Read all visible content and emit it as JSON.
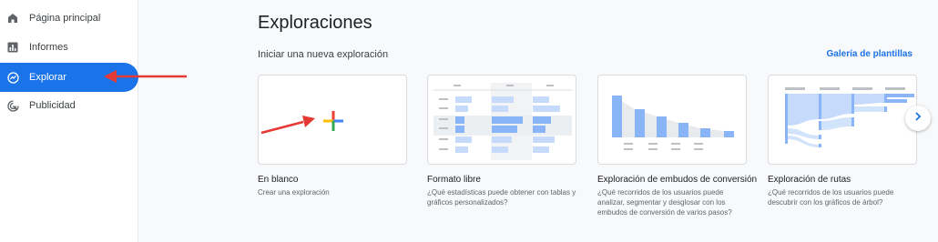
{
  "sidebar": {
    "items": [
      {
        "label": "Página principal",
        "icon": "home-icon"
      },
      {
        "label": "Informes",
        "icon": "bar-chart-icon"
      },
      {
        "label": "Explorar",
        "icon": "explore-icon",
        "active": true
      },
      {
        "label": "Publicidad",
        "icon": "advertising-icon"
      }
    ]
  },
  "header": {
    "title": "Exploraciones"
  },
  "section": {
    "title": "Iniciar una nueva exploración",
    "gallery_link": "Galería de plantillas"
  },
  "cards": [
    {
      "title": "En blanco",
      "description": "Crear una exploración"
    },
    {
      "title": "Formato libre",
      "description": "¿Qué estadísticas puede obtener con tablas y gráficos personalizados?"
    },
    {
      "title": "Exploración de embudos de conversión",
      "description": "¿Qué recorridos de los usuarios puede analizar, segmentar y desglosar con los embudos de conversión de varios pasos?"
    },
    {
      "title": "Exploración de rutas",
      "description": "¿Qué recorridos de los usuarios puede descubrir con los gráficos de árbol?"
    }
  ],
  "colors": {
    "accent": "#1a73e8",
    "annotation_arrow": "#e53935",
    "plus_red": "#ea4335",
    "plus_blue": "#4285f4",
    "plus_yellow": "#fbbc04",
    "plus_green": "#34a853"
  }
}
